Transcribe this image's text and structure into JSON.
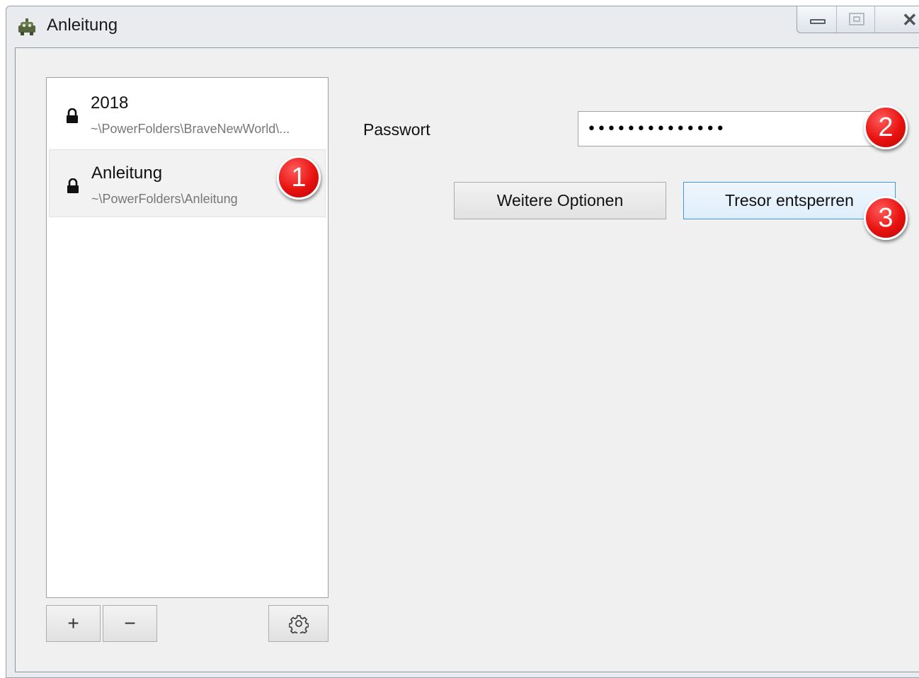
{
  "window": {
    "title": "Anleitung",
    "app_icon": "robot-icon",
    "controls": {
      "minimize": "minimize-icon",
      "maximize": "maximize-icon",
      "close": "close-icon"
    }
  },
  "vaults": [
    {
      "name": "2018",
      "path": "~\\PowerFolders\\BraveNewWorld\\...",
      "icon": "lock-icon",
      "selected": false
    },
    {
      "name": "Anleitung",
      "path": "~\\PowerFolders\\Anleitung",
      "icon": "lock-icon",
      "selected": true
    }
  ],
  "list_actions": {
    "add": "+",
    "remove": "−",
    "settings_icon": "gear-icon"
  },
  "unlock_form": {
    "password_label": "Passwort",
    "password_value": "••••••••••••••",
    "more_options_label": "Weitere Optionen",
    "unlock_label": "Tresor entsperren"
  },
  "annotations": {
    "badge_1": "1",
    "badge_2": "2",
    "badge_3": "3"
  }
}
